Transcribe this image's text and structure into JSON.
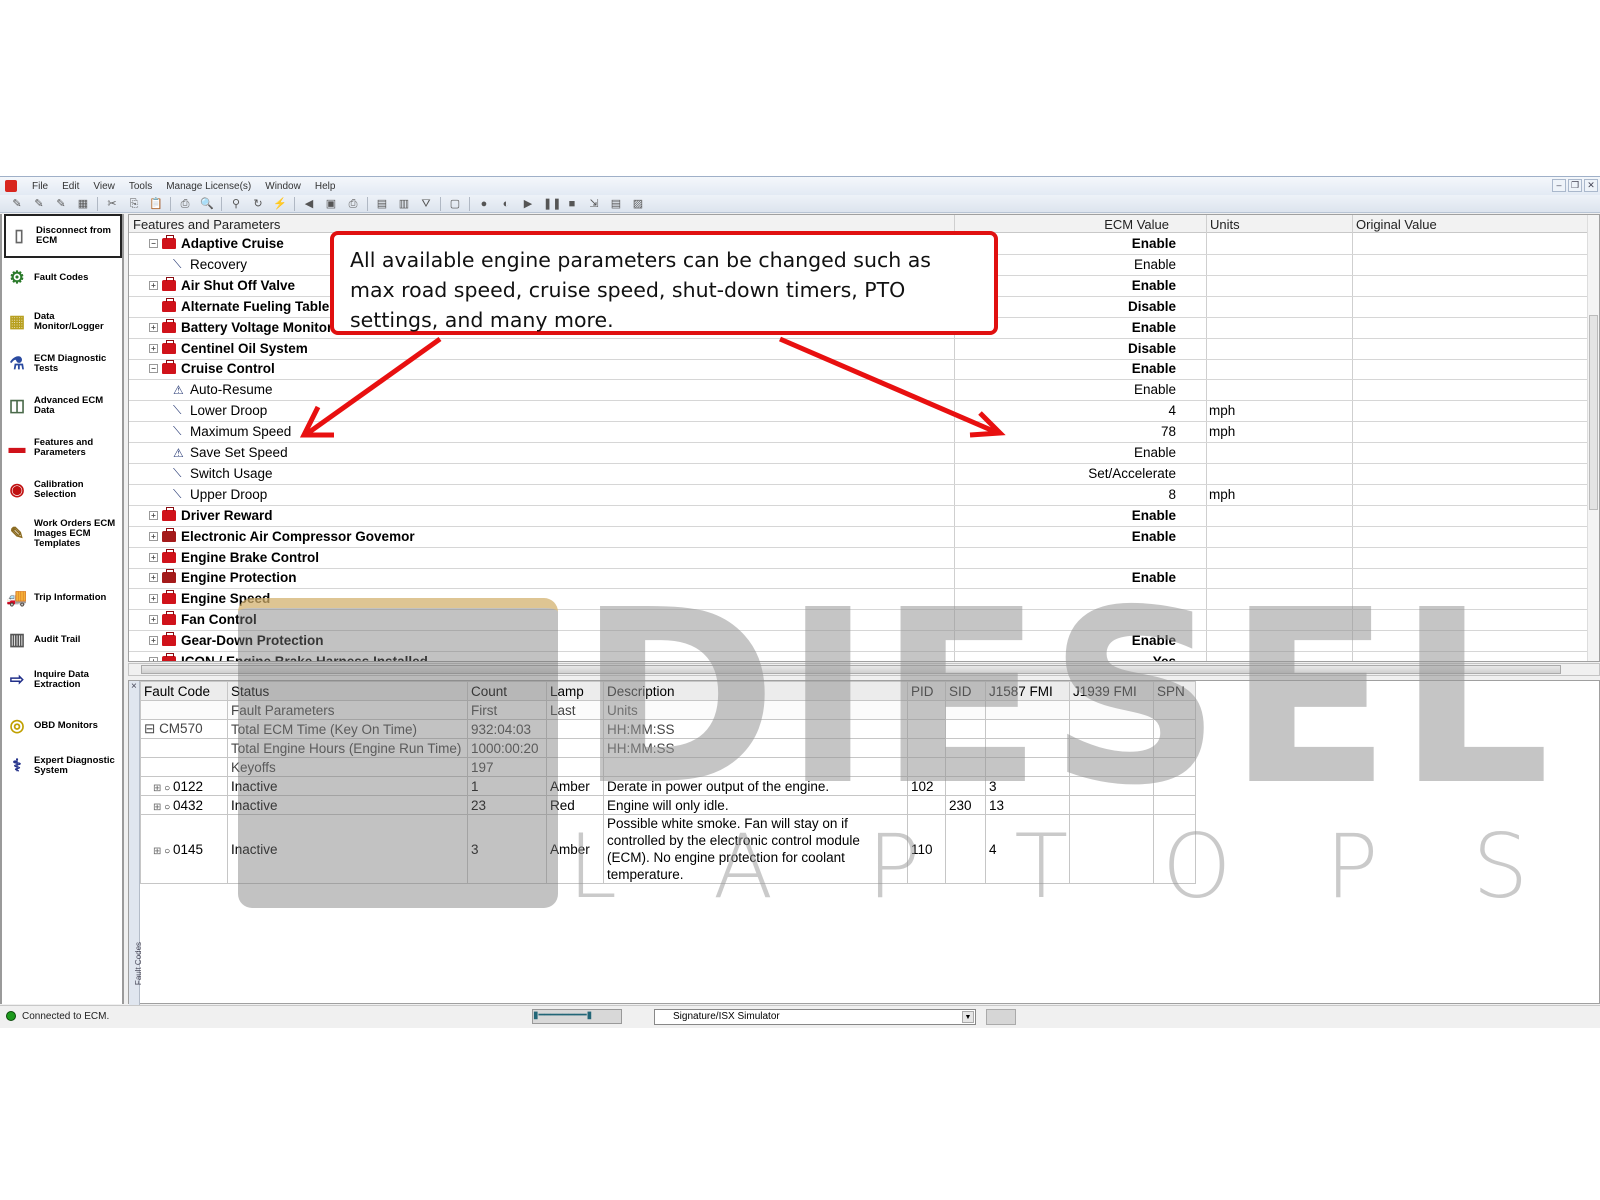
{
  "menu": [
    "File",
    "Edit",
    "View",
    "Tools",
    "Manage License(s)",
    "Window",
    "Help"
  ],
  "window_controls": [
    "minimize",
    "restore",
    "close"
  ],
  "toolbar_icons": [
    "wand-icon",
    "wand2-icon",
    "wand3-icon",
    "grid-icon",
    "cut-icon",
    "copy-icon",
    "paste-icon",
    "print-icon",
    "print-preview-icon",
    "binoculars-icon",
    "refresh-icon",
    "connect-icon",
    "back-icon",
    "ecm-icon",
    "printer2-icon",
    "doc-icon",
    "doc2-icon",
    "filter-icon",
    "page-icon",
    "record-icon",
    "rewind-icon",
    "play-icon",
    "pause-icon",
    "stop-icon",
    "export-icon",
    "report-icon",
    "notes-icon"
  ],
  "sidebar": {
    "items": [
      {
        "label": "Disconnect from ECM",
        "icon": "disconnect-icon",
        "active": true
      },
      {
        "label": "Fault Codes",
        "icon": "fault-codes-icon"
      },
      {
        "label": "Data Monitor/Logger",
        "icon": "data-monitor-icon"
      },
      {
        "label": "ECM Diagnostic Tests",
        "icon": "flask-icon"
      },
      {
        "label": "Advanced ECM Data",
        "icon": "advanced-ecm-icon"
      },
      {
        "label": "Features and Parameters",
        "icon": "toolbox-icon"
      },
      {
        "label": "Calibration Selection",
        "icon": "calibration-disc-icon"
      },
      {
        "label": "Work Orders ECM Images ECM Templates",
        "icon": "work-orders-icon"
      },
      {
        "label": "Trip Information",
        "icon": "truck-icon"
      },
      {
        "label": "Audit Trail",
        "icon": "audit-trail-icon"
      },
      {
        "label": "Inquire Data Extraction",
        "icon": "data-extraction-icon"
      },
      {
        "label": "OBD Monitors",
        "icon": "obd-icon"
      },
      {
        "label": "Expert Diagnostic System",
        "icon": "expert-diagnostic-icon"
      }
    ]
  },
  "features": {
    "columns": {
      "name": "Features and Parameters",
      "ecm_value": "ECM Value",
      "units": "Units",
      "original": "Original Value"
    },
    "rows": [
      {
        "name": "Adaptive Cruise",
        "level": 0,
        "type": "folder",
        "expander": "−",
        "value": "Enable",
        "units": "",
        "bold": true
      },
      {
        "name": "Recovery",
        "level": 1,
        "type": "wrench",
        "value": "Enable",
        "units": ""
      },
      {
        "name": "Air Shut Off Valve",
        "level": 0,
        "type": "folder",
        "expander": "+",
        "value": "Enable",
        "units": "",
        "bold": true
      },
      {
        "name": "Alternate Fueling Table",
        "level": 0,
        "type": "folder",
        "expander": "",
        "value": "Disable",
        "units": "",
        "bold": true
      },
      {
        "name": "Battery Voltage Monitor",
        "level": 0,
        "type": "folder",
        "expander": "+",
        "value": "Enable",
        "units": "",
        "bold": true
      },
      {
        "name": "Centinel Oil System",
        "level": 0,
        "type": "folder",
        "expander": "+",
        "value": "Disable",
        "units": "",
        "bold": true
      },
      {
        "name": "Cruise Control",
        "level": 0,
        "type": "folder",
        "expander": "−",
        "value": "Enable",
        "units": "",
        "bold": true
      },
      {
        "name": "Auto-Resume",
        "level": 1,
        "type": "lock-wrench",
        "value": "Enable",
        "units": ""
      },
      {
        "name": "Lower Droop",
        "level": 1,
        "type": "wrench",
        "value": "4",
        "units": "mph"
      },
      {
        "name": "Maximum Speed",
        "level": 1,
        "type": "wrench",
        "value": "78",
        "units": "mph"
      },
      {
        "name": "Save Set Speed",
        "level": 1,
        "type": "lock-wrench",
        "value": "Enable",
        "units": ""
      },
      {
        "name": "Switch Usage",
        "level": 1,
        "type": "wrench",
        "value": "Set/Accelerate",
        "units": ""
      },
      {
        "name": "Upper Droop",
        "level": 1,
        "type": "wrench",
        "value": "8",
        "units": "mph"
      },
      {
        "name": "Driver Reward",
        "level": 0,
        "type": "folder",
        "expander": "+",
        "value": "Enable",
        "units": "",
        "bold": true
      },
      {
        "name": "Electronic Air Compressor Govemor",
        "level": 0,
        "type": "locked-folder",
        "expander": "+",
        "value": "Enable",
        "units": "",
        "bold": true
      },
      {
        "name": "Engine Brake Control",
        "level": 0,
        "type": "folder",
        "expander": "+",
        "value": "",
        "units": "",
        "bold": true
      },
      {
        "name": "Engine Protection",
        "level": 0,
        "type": "locked-folder",
        "expander": "+",
        "value": "Enable",
        "units": "",
        "bold": true
      },
      {
        "name": "Engine Speed",
        "level": 0,
        "type": "folder",
        "expander": "+",
        "value": "",
        "units": "",
        "bold": true
      },
      {
        "name": "Fan Control",
        "level": 0,
        "type": "folder",
        "expander": "+",
        "value": "",
        "units": "",
        "bold": true
      },
      {
        "name": "Gear-Down Protection",
        "level": 0,
        "type": "folder",
        "expander": "+",
        "value": "Enable",
        "units": "",
        "bold": true
      },
      {
        "name": "ICON / Engine Brake Harness Installed",
        "level": 0,
        "type": "folder",
        "expander": "+",
        "value": "Yes",
        "units": "",
        "bold": true
      }
    ]
  },
  "callout": {
    "text": "All available engine parameters can be changed such as max road speed, cruise speed, shut-down timers, PTO settings, and many more."
  },
  "faults": {
    "side_tab_label": "Fault Codes",
    "columns": [
      "Fault Code",
      "Status",
      "Count",
      "Lamp",
      "Description",
      "PID",
      "SID",
      "J1587 FMI",
      "J1939 FMI",
      "SPN"
    ],
    "sub_columns": [
      "",
      "Fault Parameters",
      "First",
      "Last",
      "Units",
      "",
      "",
      "",
      "",
      ""
    ],
    "ecm": {
      "name": "CM570",
      "params": [
        {
          "name": "Total ECM Time (Key On Time)",
          "first": "932:04:03",
          "units": "HH:MM:SS"
        },
        {
          "name": "Total Engine Hours (Engine Run Time)",
          "first": "1000:00:20",
          "units": "HH:MM:SS"
        },
        {
          "name": "Keyoffs",
          "first": "197",
          "units": ""
        }
      ]
    },
    "codes": [
      {
        "code": "0122",
        "status": "Inactive",
        "count": "1",
        "lamp": "Amber",
        "description": "Derate in power output of the engine.",
        "pid": "102",
        "sid": "",
        "j1587_fmi": "3",
        "j1939_fmi": "",
        "spn": ""
      },
      {
        "code": "0432",
        "status": "Inactive",
        "count": "23",
        "lamp": "Red",
        "description": "Engine will only idle.",
        "pid": "",
        "sid": "230",
        "j1587_fmi": "13",
        "j1939_fmi": "",
        "spn": ""
      },
      {
        "code": "0145",
        "status": "Inactive",
        "count": "3",
        "lamp": "Amber",
        "description": "Possible white smoke.  Fan will stay on if controlled by the electronic control module (ECM).  No engine protection for coolant temperature.",
        "pid": "110",
        "sid": "",
        "j1587_fmi": "4",
        "j1939_fmi": "",
        "spn": ""
      }
    ]
  },
  "statusbar": {
    "status": "Connected to ECM.",
    "device": "Signature/ISX Simulator"
  },
  "watermark": {
    "line1": "DIESEL",
    "line2": "LAPTOPS"
  },
  "colors": {
    "accent_red": "#e01010",
    "folder_red": "#d0121a",
    "status_green": "#1d9a1d"
  }
}
